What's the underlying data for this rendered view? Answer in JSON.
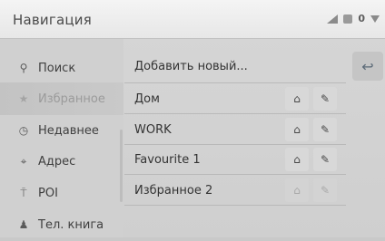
{
  "header": {
    "title": "Навигация"
  },
  "status": {
    "count": "0"
  },
  "sidebar": {
    "items": [
      {
        "label": "Поиск",
        "icon": "search-icon",
        "glyph": "⚲",
        "active": false
      },
      {
        "label": "Избранное",
        "icon": "star-icon",
        "glyph": "★",
        "active": true
      },
      {
        "label": "Недавнее",
        "icon": "clock-icon",
        "glyph": "◷",
        "active": false
      },
      {
        "label": "Адрес",
        "icon": "pin-icon",
        "glyph": "⌖",
        "active": false
      },
      {
        "label": "POI",
        "icon": "poi-icon",
        "glyph": "⍑",
        "active": false
      },
      {
        "label": "Тел. книга",
        "icon": "person-icon",
        "glyph": "♟",
        "active": false
      }
    ]
  },
  "main": {
    "add_label": "Добавить новый...",
    "back_glyph": "↩",
    "favorites": [
      {
        "name": "Дом",
        "enabled": true
      },
      {
        "name": "WORK",
        "enabled": true
      },
      {
        "name": "Favourite 1",
        "enabled": true
      },
      {
        "name": "Избранное 2",
        "enabled": false
      }
    ],
    "set_glyph": "⌂",
    "edit_glyph": "✎"
  }
}
